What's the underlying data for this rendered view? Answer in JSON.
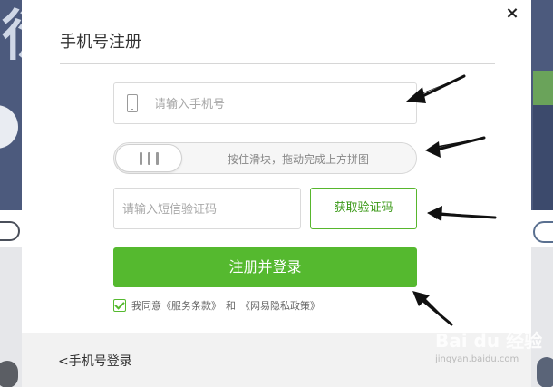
{
  "modal": {
    "title": "手机号注册",
    "close_label": "×"
  },
  "phone": {
    "placeholder": "请输入手机号",
    "icon": "mobile-phone-icon"
  },
  "slider": {
    "hint": "按住滑块，拖动完成上方拼图",
    "handle_icon": "grip-lines-icon"
  },
  "sms": {
    "placeholder": "请输入短信验证码",
    "get_code_label": "获取验证码"
  },
  "submit": {
    "label": "注册并登录"
  },
  "agreement": {
    "checked": true,
    "prefix": "我同意",
    "terms": "《服务条款》",
    "conjunction": "和",
    "privacy": "《网易隐私政策》"
  },
  "footer": {
    "back_label": "<手机号登录"
  },
  "watermark": {
    "main": "Bai du 经验",
    "sub": "jingyan.baidu.com"
  },
  "background": {
    "glyph": "衍"
  },
  "colors": {
    "accent_green": "#55b92f",
    "background_navy": "#4c5a7d"
  }
}
